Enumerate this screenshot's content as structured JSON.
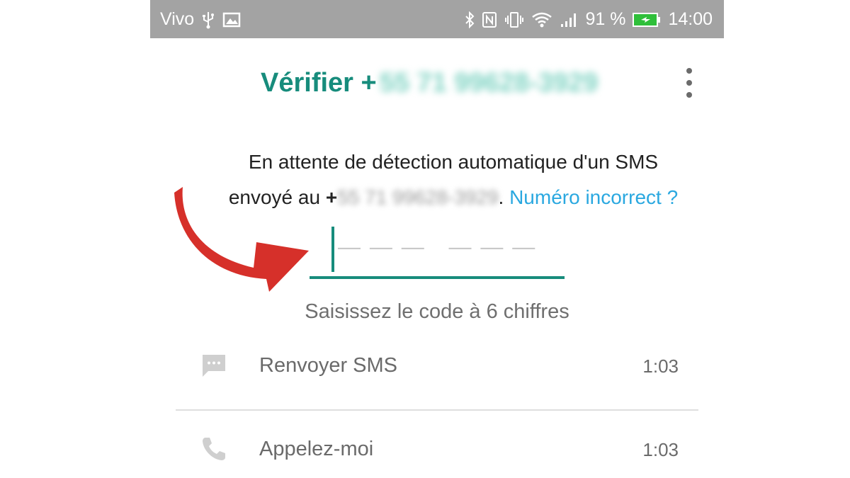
{
  "status_bar": {
    "carrier": "Vivo",
    "battery": "91 %",
    "time": "14:00",
    "icons": [
      "usb-icon",
      "gallery-icon",
      "bluetooth-icon",
      "nfc-icon",
      "vibrate-icon",
      "wifi-icon",
      "signal-icon",
      "battery-charging-icon"
    ]
  },
  "header": {
    "title_prefix": "Vérifier +",
    "title_number": "55 71 99628-3929",
    "menu_icon": "more-vert-icon"
  },
  "message": {
    "line1": "En attente de détection automatique d'un SMS",
    "line2_prefix": "envoyé au ",
    "plus": "+",
    "number": "55 71 99628-3929",
    "period": ".",
    "link": "Numéro incorrect ?"
  },
  "code_input": {
    "placeholder": "— — —   — — —"
  },
  "hint": "Saisissez le code à 6 chiffres",
  "options": [
    {
      "label": "Renvoyer SMS",
      "time": "1:03",
      "icon": "message-icon"
    },
    {
      "label": "Appelez-moi",
      "time": "1:03",
      "icon": "phone-icon"
    }
  ],
  "colors": {
    "accent": "#178c7c",
    "link": "#2aa8e0",
    "arrow": "#d6302a",
    "status_bar": "#a3a3a3"
  }
}
